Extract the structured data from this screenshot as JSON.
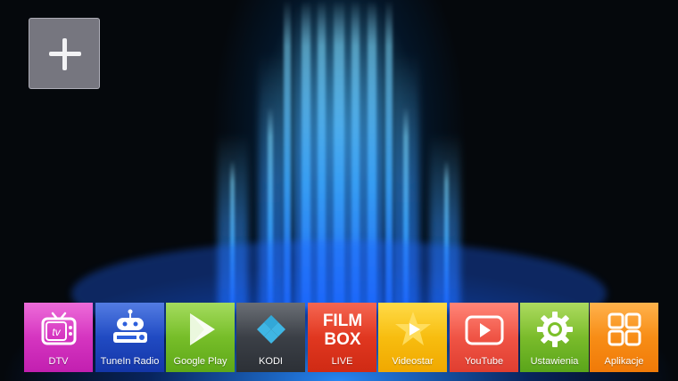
{
  "home": {
    "add_tile": {
      "icon": "plus-icon"
    },
    "dock": [
      {
        "key": "dtv",
        "label": "DTV",
        "icon": "tv-icon",
        "color": "#e84bd0",
        "color2": "#c21fb0"
      },
      {
        "key": "tunein",
        "label": "TuneIn Radio",
        "icon": "radio-robot-icon",
        "color": "#2d5fdc",
        "color2": "#1436a8"
      },
      {
        "key": "google-play",
        "label": "Google Play",
        "icon": "play-triangle-icon",
        "color": "#8fd33a",
        "color2": "#5ea818"
      },
      {
        "key": "kodi",
        "label": "KODI",
        "icon": "kodi-logo-icon",
        "color": "#4a4f57",
        "color2": "#2c3036"
      },
      {
        "key": "filmbox",
        "label": "LIVE",
        "icon": "filmbox-logo-icon",
        "logo_text": [
          "FILM",
          "BOX"
        ],
        "color": "#f2452c",
        "color2": "#cf2a14"
      },
      {
        "key": "videostar",
        "label": "Videostar",
        "icon": "star-play-icon",
        "color": "#ffd21f",
        "color2": "#f0a800"
      },
      {
        "key": "youtube",
        "label": "YouTube",
        "icon": "youtube-play-icon",
        "color": "#ff6a5a",
        "color2": "#e03e30"
      },
      {
        "key": "settings",
        "label": "Ustawienia",
        "icon": "gear-icon",
        "color": "#9ad23c",
        "color2": "#5aa51a"
      },
      {
        "key": "apps",
        "label": "Aplikacje",
        "icon": "apps-grid-icon",
        "color": "#ffa024",
        "color2": "#f07a08"
      }
    ]
  }
}
